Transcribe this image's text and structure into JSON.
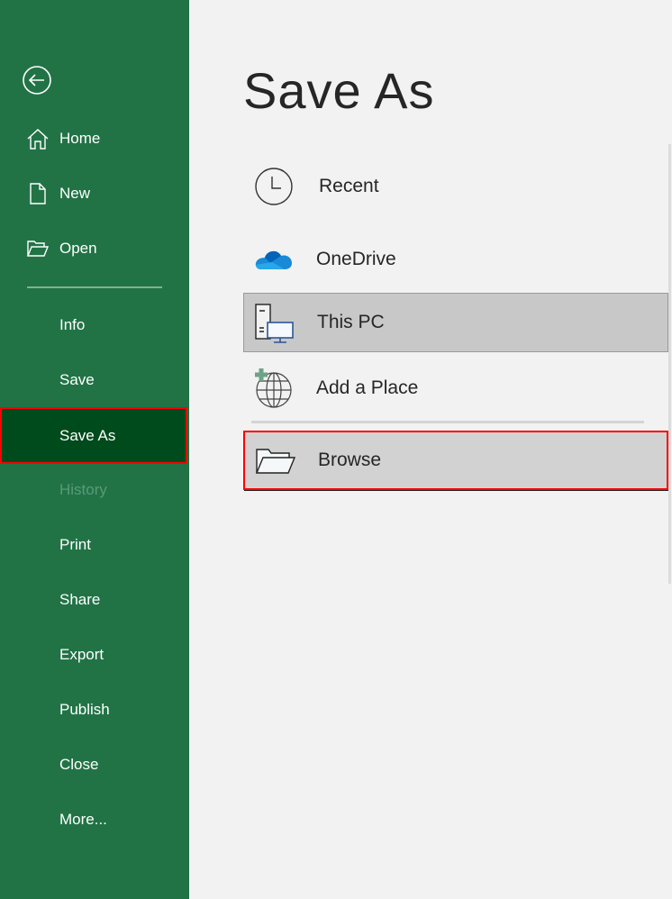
{
  "sidebar": {
    "back_label": "Back",
    "items": [
      {
        "label": "Home",
        "icon": "home-icon"
      },
      {
        "label": "New",
        "icon": "new-document-icon"
      },
      {
        "label": "Open",
        "icon": "open-folder-icon"
      },
      {
        "label": "Info"
      },
      {
        "label": "Save"
      },
      {
        "label": "Save As",
        "state": "active"
      },
      {
        "label": "History",
        "state": "disabled"
      },
      {
        "label": "Print"
      },
      {
        "label": "Share"
      },
      {
        "label": "Export"
      },
      {
        "label": "Publish"
      },
      {
        "label": "Close"
      },
      {
        "label": "More..."
      }
    ]
  },
  "main": {
    "title": "Save As",
    "locations": [
      {
        "label": "Recent",
        "icon": "clock-icon"
      },
      {
        "label": "OneDrive",
        "icon": "onedrive-cloud-icon"
      },
      {
        "label": "This PC",
        "icon": "this-pc-icon",
        "state": "selected"
      },
      {
        "label": "Add a Place",
        "icon": "add-place-globe-icon"
      },
      {
        "label": "Browse",
        "icon": "browse-folder-icon",
        "state": "focused"
      }
    ]
  },
  "colors": {
    "sidebar_bg": "#217346",
    "sidebar_active_bg": "#004b1c",
    "highlight_border": "#ff0000",
    "main_bg": "#f2f2f2"
  }
}
